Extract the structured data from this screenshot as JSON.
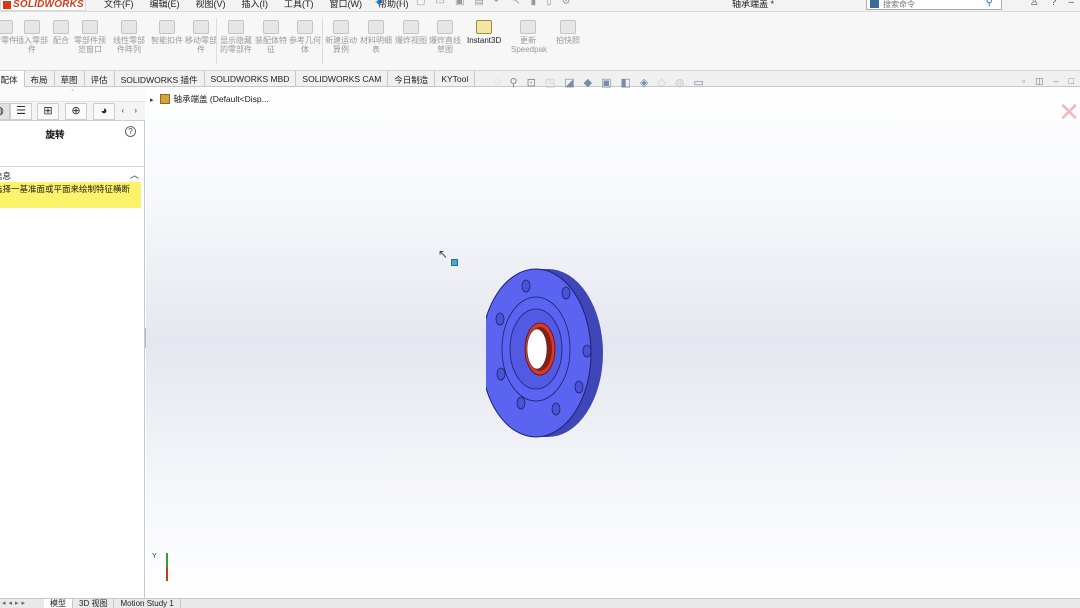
{
  "app": {
    "brand": "SOLIDWORKS",
    "document_title": "轴承端盖 *"
  },
  "menu": [
    "文件(F)",
    "编辑(E)",
    "视图(V)",
    "插入(I)",
    "工具(T)",
    "窗口(W)",
    "帮助(H)"
  ],
  "search": {
    "placeholder": "搜索命令"
  },
  "ribbon": {
    "buttons": [
      {
        "label": "新零件"
      },
      {
        "label": "插入零部件"
      },
      {
        "label": "配合"
      },
      {
        "label": "零部件预览窗口"
      },
      {
        "label": "线性零部件阵列"
      },
      {
        "label": "智能扣件"
      },
      {
        "label": "移动零部件"
      },
      {
        "label": "显示隐藏的零部件"
      },
      {
        "label": "装配体特征"
      },
      {
        "label": "参考几何体"
      },
      {
        "label": "新建运动算例"
      },
      {
        "label": "材料明细表"
      },
      {
        "label": "爆炸视图"
      },
      {
        "label": "爆炸直线草图"
      },
      {
        "label": "Instant3D"
      },
      {
        "label": "更新Speedpak"
      },
      {
        "label": "拍快照"
      }
    ]
  },
  "tabs": [
    "装配体",
    "布局",
    "草图",
    "评估",
    "SOLIDWORKS 插件",
    "SOLIDWORKS MBD",
    "SOLIDWORKS CAM",
    "今日制造",
    "KYTool"
  ],
  "property_manager": {
    "title": "旋转",
    "message_header": "信息",
    "message": "选择一基准面或平面来绘制特征横断"
  },
  "feature_tree": {
    "root": "轴承端盖  (Default<Disp..."
  },
  "bottom_tabs": [
    "模型",
    "3D 视图",
    "Motion Study 1"
  ],
  "colors": {
    "part_blue": "#5a64f0",
    "bore_red": "#d83a2a",
    "message_bg": "#fdf36a",
    "brand_red": "#d33a1c"
  }
}
